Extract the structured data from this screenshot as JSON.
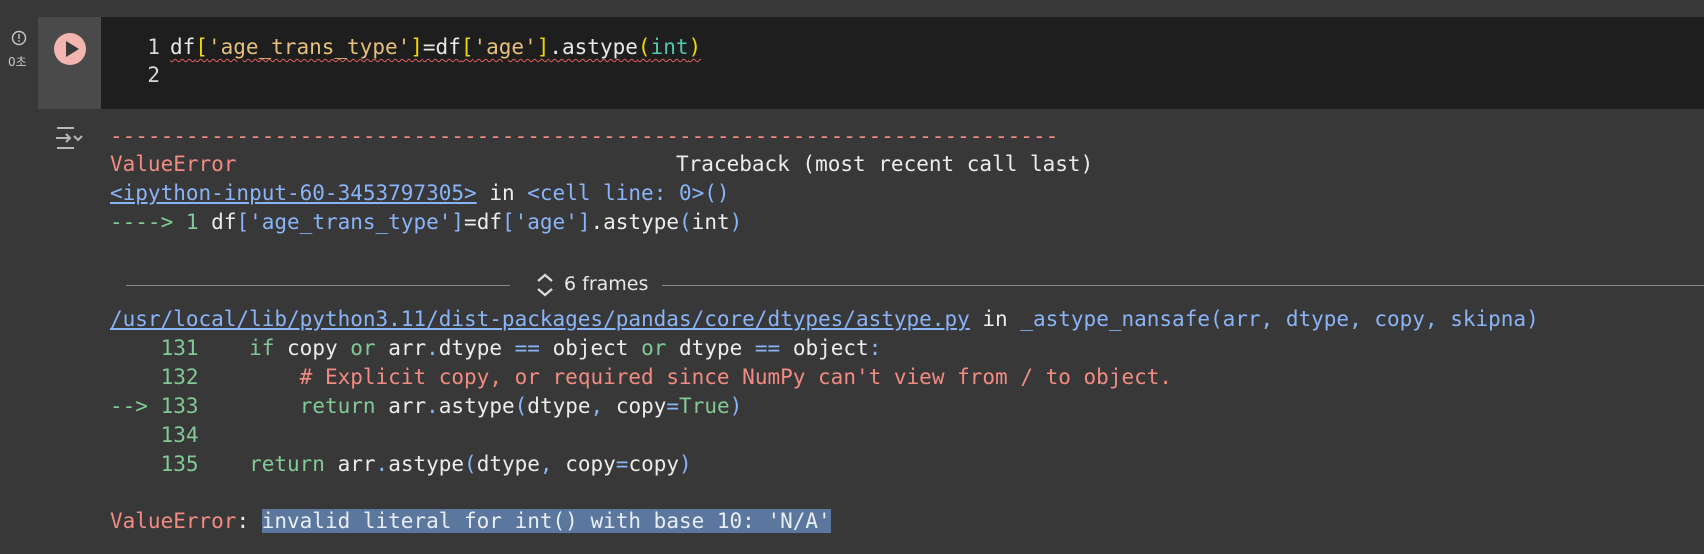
{
  "status": {
    "icon": "error-circle-icon",
    "time": "0초"
  },
  "run_button": {
    "icon": "play-icon"
  },
  "code": {
    "lines": [
      {
        "num": "1",
        "tokens": [
          "df",
          "[",
          "'age_trans_type'",
          "]",
          "=df",
          "[",
          "'age'",
          "]",
          ".astype",
          "(",
          "int",
          ")"
        ]
      },
      {
        "num": "2",
        "tokens": []
      }
    ]
  },
  "output": {
    "icon": "output-toggle-icon",
    "dashes": "---------------------------------------------------------------------------",
    "error_name": "ValueError",
    "traceback_label": "Traceback (most recent call last)",
    "input_link": "<ipython-input-60-3453797305>",
    "in_word": "in",
    "cell_line": "<cell line: 0>()",
    "arrow_line_prefix": "----> 1",
    "arrow_line_code": {
      "a": "df",
      "b": "['age_trans_type']",
      "c": "=df",
      "d": "['age']",
      "e": ".astype",
      "f": "(",
      "g": "int",
      "h": ")"
    },
    "frames": {
      "icon": "expand-vertical-icon",
      "label": "6 frames"
    },
    "file_link": "/usr/local/lib/python3.11/dist-packages/pandas/core/dtypes/astype.py",
    "file_in": "in",
    "file_func": "_astype_nansafe(arr, dtype, copy, skipna)",
    "source": [
      {
        "prefix": "",
        "num": "131",
        "indent": "    ",
        "parts": {
          "kw": "if",
          "a": " copy ",
          "kw2": "or",
          "b": " arr",
          "dot": ".",
          "c": "dtype ",
          "op": "==",
          "d": " object ",
          "kw3": "or",
          "e": " dtype ",
          "op2": "==",
          "f": " object",
          "g": ":"
        }
      },
      {
        "prefix": "",
        "num": "132",
        "indent": "        ",
        "comment": "# Explicit copy, or required since NumPy can't view from / to object."
      },
      {
        "prefix": "-->",
        "num": "133",
        "indent": "        ",
        "parts": {
          "kw": "return",
          "a": " arr",
          "dot": ".",
          "b": "astype",
          "c": "(",
          "d": "dtype",
          "e": ",",
          "f": " copy",
          "g": "=",
          "h": "True",
          "i": ")"
        }
      },
      {
        "prefix": "",
        "num": "134"
      },
      {
        "prefix": "",
        "num": "135",
        "indent": "    ",
        "parts": {
          "kw": "return",
          "a": " arr",
          "dot": ".",
          "b": "astype",
          "c": "(",
          "d": "dtype",
          "e": ",",
          "f": " copy",
          "g": "=",
          "h": "copy",
          "i": ")"
        }
      }
    ],
    "final_error_name": "ValueError",
    "final_colon": ": ",
    "final_message": "invalid literal for int() with base 10: 'N/A'"
  },
  "colors": {
    "background": "#383838",
    "editor_bg": "#1e1e1e",
    "error_red": "#f28b82",
    "green": "#81c995",
    "blue": "#8ab4f8",
    "selection": "#5c779e"
  }
}
